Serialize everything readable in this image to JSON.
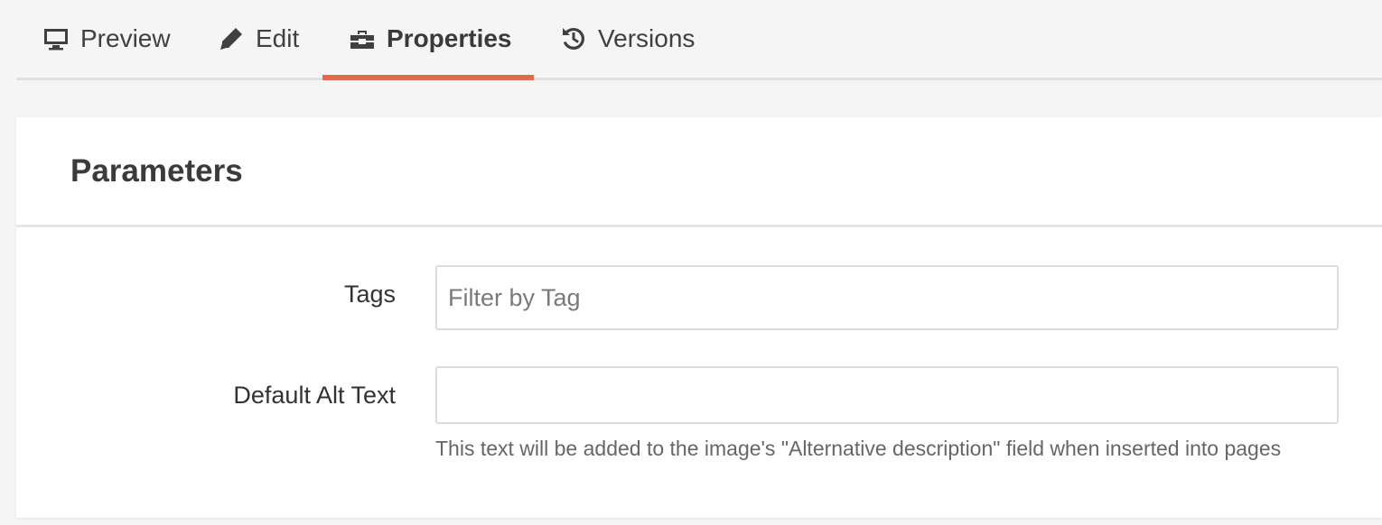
{
  "tabs": [
    {
      "label": "Preview",
      "icon": "monitor-icon",
      "active": false
    },
    {
      "label": "Edit",
      "icon": "pencil-icon",
      "active": false
    },
    {
      "label": "Properties",
      "icon": "toolbox-icon",
      "active": true
    },
    {
      "label": "Versions",
      "icon": "history-icon",
      "active": false
    }
  ],
  "panel": {
    "title": "Parameters",
    "fields": {
      "tags": {
        "label": "Tags",
        "placeholder": "Filter by Tag",
        "value": ""
      },
      "alt_text": {
        "label": "Default Alt Text",
        "value": "",
        "help": "This text will be added to the image's \"Alternative description\" field when inserted into pages"
      }
    }
  },
  "colors": {
    "accent": "#e9664b",
    "background": "#f5f5f5",
    "panel": "#ffffff"
  }
}
